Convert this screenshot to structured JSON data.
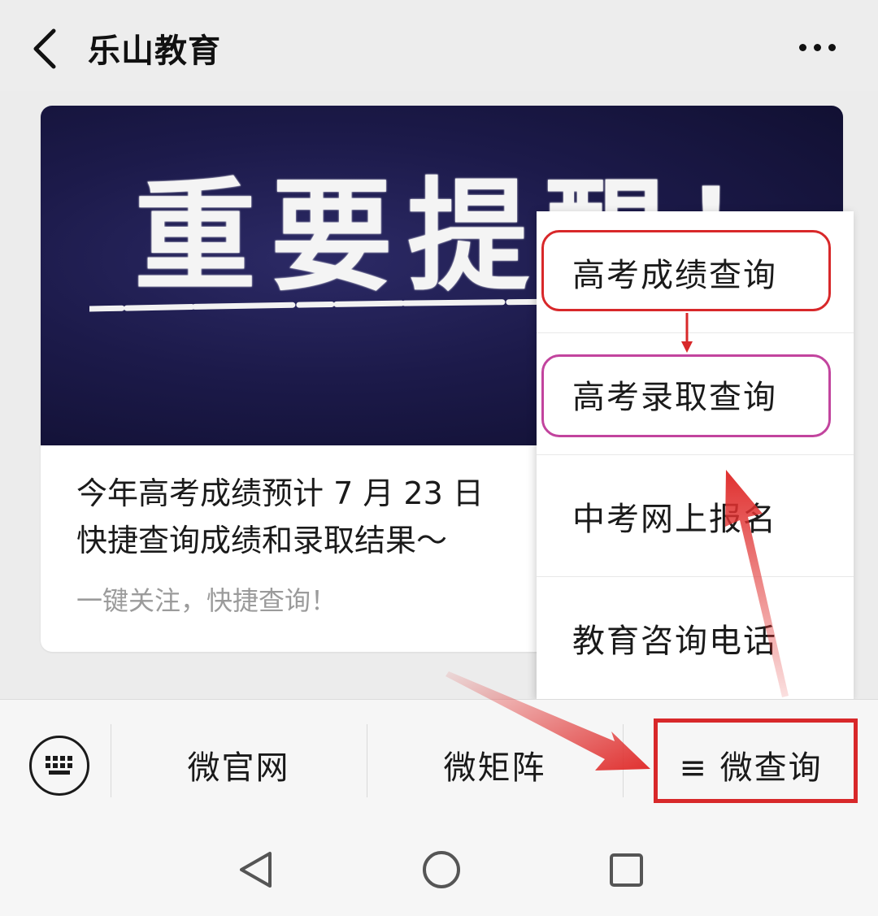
{
  "header": {
    "title": "乐山教育"
  },
  "article": {
    "banner_text": "重要提醒！",
    "title_line1": "今年高考成绩预计 7 月 23 日",
    "title_line2": "快捷查询成绩和录取结果～",
    "subtitle": "一键关注，快捷查询！"
  },
  "popup_menu": {
    "items": [
      {
        "label": "高考成绩查询"
      },
      {
        "label": "高考录取查询"
      },
      {
        "label": "中考网上报名"
      },
      {
        "label": "教育咨询电话"
      }
    ]
  },
  "bottom_menu": {
    "items": [
      {
        "label": "微官网"
      },
      {
        "label": "微矩阵"
      },
      {
        "label": "≡ 微查询"
      }
    ]
  },
  "colors": {
    "highlight_red": "#d8282a",
    "highlight_purple": "#c2449e",
    "arrow_red": "#e0302f"
  }
}
